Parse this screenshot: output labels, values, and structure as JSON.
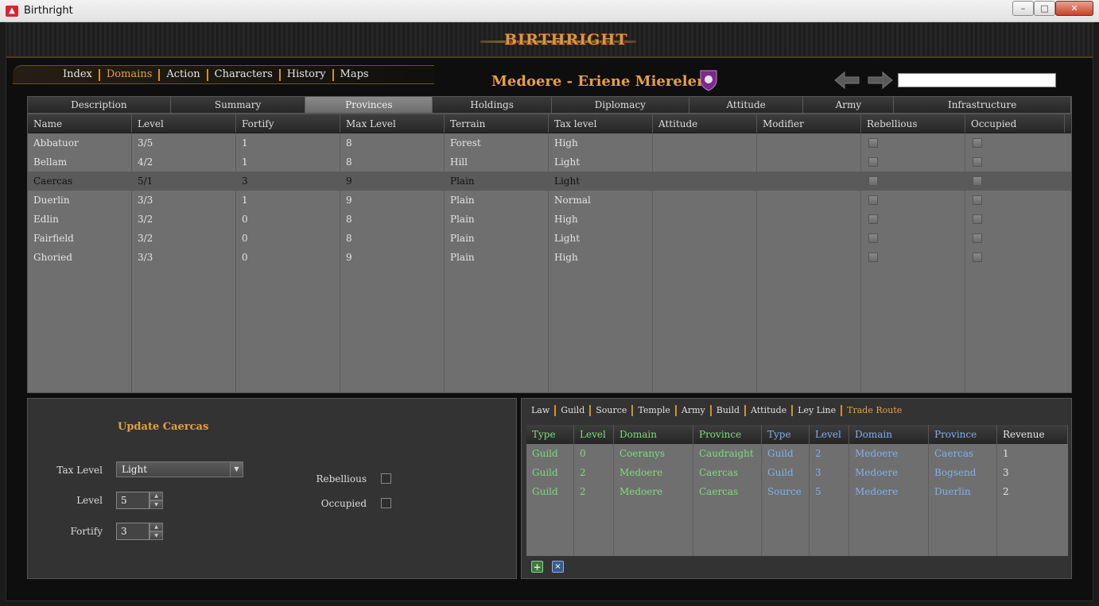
{
  "window": {
    "title": "Birthright",
    "minimize": "–",
    "maximize": "□",
    "close": "✕"
  },
  "app": {
    "logo_text": "BIRTHRIGHT"
  },
  "nav": [
    "Index",
    "Domains",
    "Action",
    "Characters",
    "History",
    "Maps"
  ],
  "nav_active": "Domains",
  "domain_title": "Medoere - Eriene Mierelen",
  "search": {
    "value": ""
  },
  "tabs": [
    "Description",
    "Summary",
    "Provinces",
    "Holdings",
    "Diplomacy",
    "Attitude",
    "Army",
    "Infrastructure"
  ],
  "tabs_active": "Provinces",
  "provinces": {
    "columns": [
      "Name",
      "Level",
      "Fortify",
      "Max Level",
      "Terrain",
      "Tax level",
      "Attitude",
      "Modifier",
      "Rebellious",
      "Occupied"
    ],
    "rows": [
      {
        "name": "Abbatuor",
        "level": "3/5",
        "fortify": "1",
        "max_level": "8",
        "terrain": "Forest",
        "tax": "High",
        "attitude": "",
        "modifier": ""
      },
      {
        "name": "Bellam",
        "level": "4/2",
        "fortify": "1",
        "max_level": "8",
        "terrain": "Hill",
        "tax": "Light",
        "attitude": "",
        "modifier": ""
      },
      {
        "name": "Caercas",
        "level": "5/1",
        "fortify": "3",
        "max_level": "9",
        "terrain": "Plain",
        "tax": "Light",
        "attitude": "",
        "modifier": ""
      },
      {
        "name": "Duerlin",
        "level": "3/3",
        "fortify": "1",
        "max_level": "9",
        "terrain": "Plain",
        "tax": "Normal",
        "attitude": "",
        "modifier": ""
      },
      {
        "name": "Edlin",
        "level": "3/2",
        "fortify": "0",
        "max_level": "8",
        "terrain": "Plain",
        "tax": "High",
        "attitude": "",
        "modifier": ""
      },
      {
        "name": "Fairfield",
        "level": "3/2",
        "fortify": "0",
        "max_level": "8",
        "terrain": "Plain",
        "tax": "Light",
        "attitude": "",
        "modifier": ""
      },
      {
        "name": "Ghoried",
        "level": "3/3",
        "fortify": "0",
        "max_level": "9",
        "terrain": "Plain",
        "tax": "High",
        "attitude": "",
        "modifier": ""
      }
    ],
    "selected": "Caercas"
  },
  "update": {
    "title": "Update Caercas",
    "tax_label": "Tax Level",
    "tax_value": "Light",
    "level_label": "Level",
    "level_value": "5",
    "fortify_label": "Fortify",
    "fortify_value": "3",
    "rebellious_label": "Rebellious",
    "occupied_label": "Occupied"
  },
  "holdings_tabs": [
    "Law",
    "Guild",
    "Source",
    "Temple",
    "Army",
    "Build",
    "Attitude",
    "Ley Line",
    "Trade Route"
  ],
  "holdings_tabs_active": "Trade Route",
  "trade": {
    "columns": [
      "Type",
      "Level",
      "Domain",
      "Province",
      "Type",
      "Level",
      "Domain",
      "Province",
      "Revenue"
    ],
    "rows": [
      [
        "Guild",
        "0",
        "Coeranys",
        "Caudraight",
        "Guild",
        "2",
        "Medoere",
        "Caercas",
        "1"
      ],
      [
        "Guild",
        "2",
        "Medoere",
        "Caercas",
        "Guild",
        "3",
        "Medoere",
        "Bogsend",
        "3"
      ],
      [
        "Guild",
        "2",
        "Medoere",
        "Caercas",
        "Source",
        "5",
        "Medoere",
        "Duerlin",
        "2"
      ]
    ]
  },
  "icons": {
    "add": "+",
    "remove": "×",
    "dropdown": "▼",
    "up": "▲",
    "down": "▼"
  },
  "colors": {
    "accent": "#e4a045",
    "source_side": "#7ddc7d",
    "target_side": "#7fb0ee"
  }
}
